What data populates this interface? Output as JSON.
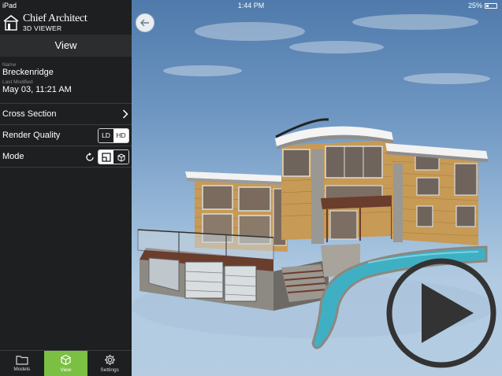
{
  "status": {
    "carrier": "iPad",
    "time": "1:44 PM",
    "battery": "25%"
  },
  "app": {
    "brand": "Chief Architect",
    "subtitle": "3D VIEWER"
  },
  "panel": {
    "title": "View"
  },
  "model": {
    "name_label": "Name",
    "name": "Breckenridge",
    "modified_label": "Last Modified",
    "modified": "May 03, 11:21 AM"
  },
  "settings": {
    "cross_section": "Cross Section",
    "render_quality": "Render Quality",
    "quality_options": [
      "LD",
      "HD"
    ],
    "quality_selected": "LD",
    "mode": "Mode"
  },
  "tabs": [
    {
      "label": "Models",
      "icon": "folder-icon"
    },
    {
      "label": "View",
      "icon": "cube-icon"
    },
    {
      "label": "Settings",
      "icon": "gear-icon"
    }
  ],
  "colors": {
    "accent": "#7bc042",
    "panel": "#1d1f20"
  }
}
